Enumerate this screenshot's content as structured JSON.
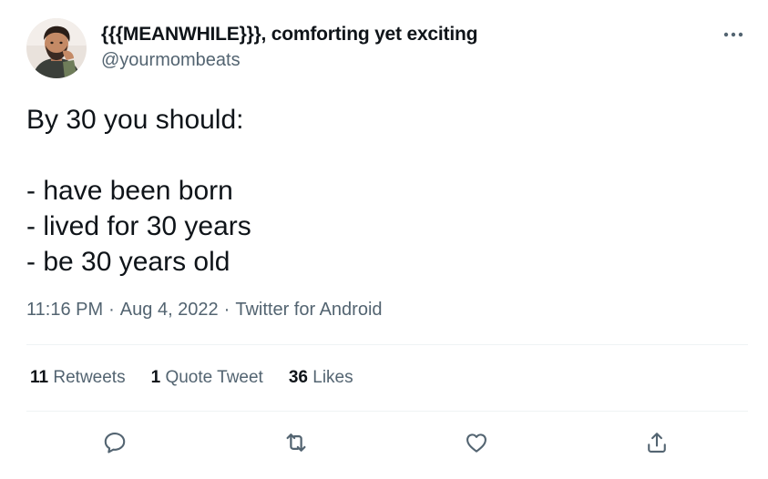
{
  "author": {
    "display_name": "{{{MEANWHILE}}}, comforting yet exciting",
    "handle": "@yourmombeats"
  },
  "tweet": {
    "text": "By 30 you should:\n\n- have been born\n- lived for 30 years\n- be 30 years old",
    "time": "11:16 PM",
    "date": "Aug 4, 2022",
    "separator": "·",
    "source": "Twitter for Android"
  },
  "stats": {
    "retweets_count": "11",
    "retweets_label": "Retweets",
    "quotes_count": "1",
    "quotes_label": "Quote Tweet",
    "likes_count": "36",
    "likes_label": "Likes"
  },
  "icons": {
    "more": "more-horizontal-icon",
    "reply": "reply-icon",
    "retweet": "retweet-icon",
    "like": "heart-icon",
    "share": "share-icon"
  },
  "colors": {
    "text": "#0f1419",
    "secondary": "#536471",
    "divider": "#eff3f4"
  }
}
